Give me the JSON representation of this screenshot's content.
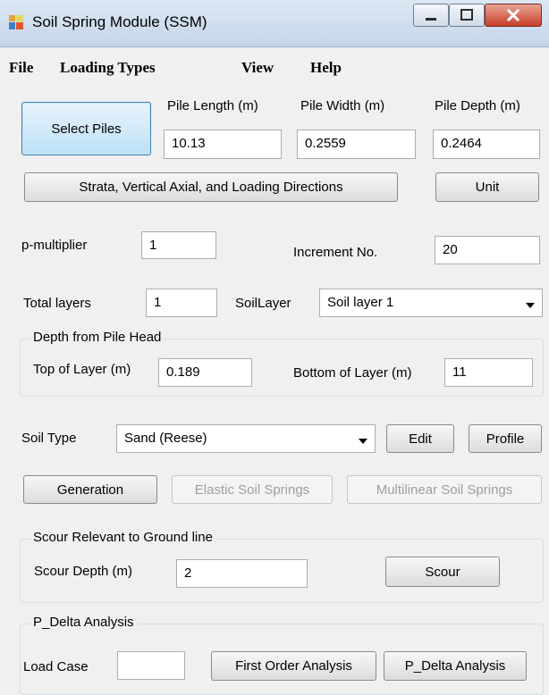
{
  "window": {
    "title": "Soil Spring Module (SSM)"
  },
  "menu": {
    "file": "File",
    "loading_types": "Loading Types",
    "view": "View",
    "help": "Help"
  },
  "buttons": {
    "select_piles": "Select Piles",
    "strata": "Strata, Vertical Axial, and Loading Directions",
    "unit": "Unit",
    "edit": "Edit",
    "profile": "Profile",
    "generation": "Generation",
    "elastic": "Elastic Soil Springs",
    "multilinear": "Multilinear Soil Springs",
    "scour": "Scour",
    "first_order": "First Order Analysis",
    "p_delta": "P_Delta Analysis"
  },
  "pile": {
    "length_label": "Pile Length (m)",
    "length_value": "10.13",
    "width_label": "Pile Width (m)",
    "width_value": "0.2559",
    "depth_label": "Pile Depth (m)",
    "depth_value": "0.2464"
  },
  "params": {
    "p_multiplier_label": "p-multiplier",
    "p_multiplier_value": "1",
    "increment_label": "Increment No.",
    "increment_value": "20",
    "total_layers_label": "Total layers",
    "total_layers_value": "1",
    "soil_layer_label": "SoilLayer",
    "soil_layer_value": "Soil layer 1"
  },
  "depth_group": {
    "legend": "Depth from Pile Head",
    "top_label": "Top of Layer (m)",
    "top_value": "0.189",
    "bottom_label": "Bottom of Layer (m)",
    "bottom_value": "11"
  },
  "soil": {
    "type_label": "Soil Type",
    "type_value": "Sand (Reese)"
  },
  "scour_group": {
    "legend": "Scour Relevant to Ground line",
    "depth_label": "Scour Depth (m)",
    "depth_value": "2"
  },
  "pdelta_group": {
    "legend": "P_Delta Analysis",
    "load_case_label": "Load Case",
    "load_case_value": ""
  }
}
